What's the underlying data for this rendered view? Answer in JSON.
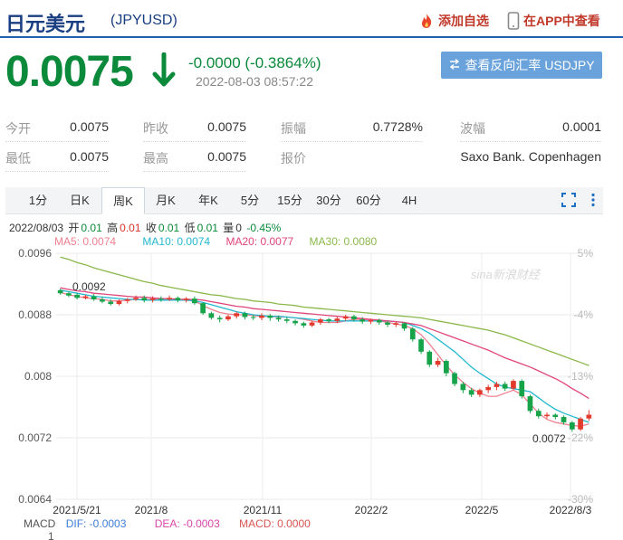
{
  "header": {
    "title": "日元美元",
    "code": "(JPYUSD)",
    "add_watch": "添加自选",
    "app_view": "在APP中查看"
  },
  "quote": {
    "price": "0.0075",
    "change": "-0.0000 (-0.3864%)",
    "time": "2022-08-03 08:57:22",
    "reverse_label": "查看反向汇率 USDJPY"
  },
  "stats": [
    {
      "label": "今开",
      "value": "0.0075"
    },
    {
      "label": "昨收",
      "value": "0.0075"
    },
    {
      "label": "振幅",
      "value": "0.7728%"
    },
    {
      "label": "波幅",
      "value": "0.0001"
    },
    {
      "label": "最低",
      "value": "0.0075"
    },
    {
      "label": "最高",
      "value": "0.0075"
    },
    {
      "label": "报价",
      "value": "Saxo Bank. Copenhagen"
    }
  ],
  "tabs": [
    "1分",
    "日K",
    "周K",
    "月K",
    "年K",
    "5分",
    "15分",
    "30分",
    "60分",
    "4H"
  ],
  "active_tab": "周K",
  "ohlc": {
    "date": "2022/08/03",
    "open_label": "开",
    "open": "0.01",
    "high_label": "高",
    "high": "0.01",
    "close_label": "收",
    "close": "0.01",
    "low_label": "低",
    "low": "0.01",
    "vol_label": "量",
    "vol": "0",
    "pct": "-0.45%"
  },
  "ma_legend": [
    {
      "text": "MA5: 0.0074",
      "color": "#f08090"
    },
    {
      "text": "MA10: 0.0074",
      "color": "#22b8cf"
    },
    {
      "text": "MA20: 0.0077",
      "color": "#e0457b"
    },
    {
      "text": "MA30: 0.0080",
      "color": "#8ab84a"
    }
  ],
  "macd": {
    "label": "MACD",
    "dif": "DIF: -0.0003",
    "dea": "DEA: -0.0003",
    "macd": "MACD: 0.0000",
    "dif_color": "#3b7dd8",
    "dea_color": "#d946a8",
    "macd_color": "#d9534f",
    "scale_top": "1"
  },
  "watermark": "sina新浪财经",
  "chart_data": {
    "type": "candlestick",
    "y_ticks": [
      "0.0096",
      "0.0088",
      "0.008",
      "0.0072",
      "0.0064"
    ],
    "ylim": [
      0.0064,
      0.0096
    ],
    "pct_ticks": [
      "5%",
      "-4%",
      "-13%",
      "-22%",
      "-30%"
    ],
    "x_ticks": [
      "2021/5/21",
      "2021/8",
      "2021/11",
      "2022/2",
      "2022/5",
      "2022/8/3"
    ],
    "max_label": "0.0092",
    "min_label": "0.0072",
    "series": [
      {
        "name": "MA5",
        "color": "#f08090",
        "values": [
          0.00909,
          0.00906,
          0.00904,
          0.00902,
          0.00901,
          0.009,
          0.00898,
          0.00898,
          0.00899,
          0.009,
          0.009,
          0.009,
          0.009,
          0.00899,
          0.00899,
          0.00899,
          0.00898,
          0.00892,
          0.00887,
          0.00883,
          0.00881,
          0.0088,
          0.0088,
          0.00879,
          0.00878,
          0.00878,
          0.00877,
          0.00877,
          0.00876,
          0.00874,
          0.00872,
          0.0087,
          0.0087,
          0.0087,
          0.00872,
          0.00874,
          0.00874,
          0.00873,
          0.00872,
          0.0087,
          0.00868,
          0.00866,
          0.00862,
          0.00854,
          0.00842,
          0.00828,
          0.00814,
          0.00802,
          0.00792,
          0.00784,
          0.00778,
          0.00774,
          0.00774,
          0.00778,
          0.00782,
          0.00776,
          0.00764,
          0.00752,
          0.00744,
          0.0074,
          0.00738,
          0.00736,
          0.00735,
          0.00738
        ]
      },
      {
        "name": "MA10",
        "color": "#22b8cf",
        "values": [
          0.00912,
          0.0091,
          0.00908,
          0.00906,
          0.00904,
          0.00903,
          0.00902,
          0.00901,
          0.009,
          0.009,
          0.00899,
          0.00899,
          0.00899,
          0.00899,
          0.00899,
          0.00899,
          0.00898,
          0.00896,
          0.00893,
          0.0089,
          0.00887,
          0.00884,
          0.00882,
          0.0088,
          0.00879,
          0.00878,
          0.00878,
          0.00877,
          0.00876,
          0.00875,
          0.00874,
          0.00873,
          0.00872,
          0.00872,
          0.00872,
          0.00872,
          0.00872,
          0.00872,
          0.00872,
          0.00872,
          0.00871,
          0.0087,
          0.00866,
          0.00862,
          0.00856,
          0.00848,
          0.0084,
          0.00832,
          0.00822,
          0.00812,
          0.00804,
          0.00797,
          0.0079,
          0.00786,
          0.00784,
          0.00782,
          0.0078,
          0.00772,
          0.00764,
          0.00757,
          0.00752,
          0.00748,
          0.00744,
          0.0074
        ]
      },
      {
        "name": "MA20",
        "color": "#e0457b",
        "values": [
          0.00915,
          0.00913,
          0.00911,
          0.0091,
          0.00908,
          0.00907,
          0.00906,
          0.00905,
          0.00904,
          0.00903,
          0.00903,
          0.00902,
          0.00901,
          0.00901,
          0.009,
          0.009,
          0.009,
          0.00899,
          0.00897,
          0.00895,
          0.00893,
          0.00891,
          0.0089,
          0.00888,
          0.00887,
          0.00886,
          0.00885,
          0.00884,
          0.00883,
          0.00882,
          0.00881,
          0.0088,
          0.00879,
          0.00878,
          0.00877,
          0.00876,
          0.00875,
          0.00874,
          0.00873,
          0.00872,
          0.00871,
          0.0087,
          0.00868,
          0.00866,
          0.00862,
          0.00858,
          0.00854,
          0.0085,
          0.00846,
          0.00842,
          0.00838,
          0.00834,
          0.00829,
          0.00824,
          0.0082,
          0.00816,
          0.00812,
          0.00807,
          0.00802,
          0.00797,
          0.00791,
          0.00784,
          0.00778,
          0.00771
        ]
      },
      {
        "name": "MA30",
        "color": "#8ab84a",
        "values": [
          0.00955,
          0.00952,
          0.00948,
          0.00945,
          0.00941,
          0.00938,
          0.00935,
          0.00932,
          0.00929,
          0.00926,
          0.00923,
          0.00921,
          0.00918,
          0.00916,
          0.00914,
          0.00912,
          0.0091,
          0.00908,
          0.00906,
          0.00905,
          0.00903,
          0.00901,
          0.009,
          0.00898,
          0.00897,
          0.00896,
          0.00894,
          0.00893,
          0.00892,
          0.0089,
          0.00889,
          0.00888,
          0.00887,
          0.00886,
          0.00885,
          0.00884,
          0.00883,
          0.00882,
          0.00881,
          0.0088,
          0.00879,
          0.00878,
          0.00877,
          0.00876,
          0.00874,
          0.00872,
          0.0087,
          0.00868,
          0.00866,
          0.00864,
          0.00862,
          0.0086,
          0.00857,
          0.00854,
          0.0085,
          0.00846,
          0.00842,
          0.00838,
          0.00834,
          0.0083,
          0.00826,
          0.00822,
          0.00818,
          0.00814
        ]
      }
    ],
    "candles": [
      [
        0.00912,
        0.00908,
        0.00914,
        0.00906
      ],
      [
        0.00908,
        0.00905,
        0.0091,
        0.00903
      ],
      [
        0.00906,
        0.00902,
        0.00908,
        0.009
      ],
      [
        0.00902,
        0.00904,
        0.00906,
        0.009
      ],
      [
        0.00904,
        0.009,
        0.00907,
        0.00898
      ],
      [
        0.009,
        0.00897,
        0.00903,
        0.00895
      ],
      [
        0.00897,
        0.00894,
        0.009,
        0.00892
      ],
      [
        0.00894,
        0.00898,
        0.009,
        0.00892
      ],
      [
        0.00898,
        0.009,
        0.00902,
        0.00895
      ],
      [
        0.009,
        0.00902,
        0.00905,
        0.00898
      ],
      [
        0.00902,
        0.00899,
        0.00905,
        0.00896
      ],
      [
        0.00899,
        0.00901,
        0.00904,
        0.00896
      ],
      [
        0.00901,
        0.009,
        0.00904,
        0.00897
      ],
      [
        0.009,
        0.00902,
        0.00905,
        0.00898
      ],
      [
        0.00902,
        0.00899,
        0.00904,
        0.00896
      ],
      [
        0.00899,
        0.00901,
        0.00903,
        0.00896
      ],
      [
        0.00901,
        0.00895,
        0.00904,
        0.00893
      ],
      [
        0.00895,
        0.00882,
        0.00896,
        0.0088
      ],
      [
        0.00882,
        0.00876,
        0.00884,
        0.00874
      ],
      [
        0.00876,
        0.00874,
        0.00879,
        0.0087
      ],
      [
        0.00874,
        0.00878,
        0.0088,
        0.00872
      ],
      [
        0.00878,
        0.00882,
        0.00884,
        0.00875
      ],
      [
        0.00882,
        0.00877,
        0.00884,
        0.00874
      ],
      [
        0.00877,
        0.00876,
        0.0088,
        0.00873
      ],
      [
        0.00876,
        0.00879,
        0.00882,
        0.00873
      ],
      [
        0.00879,
        0.00876,
        0.00881,
        0.00872
      ],
      [
        0.00876,
        0.00874,
        0.00879,
        0.00871
      ],
      [
        0.00874,
        0.00872,
        0.00877,
        0.00869
      ],
      [
        0.00872,
        0.00869,
        0.00874,
        0.00866
      ],
      [
        0.00869,
        0.00866,
        0.00871,
        0.00863
      ],
      [
        0.00866,
        0.0087,
        0.00872,
        0.00864
      ],
      [
        0.0087,
        0.00874,
        0.00876,
        0.00867
      ],
      [
        0.00874,
        0.00872,
        0.00876,
        0.00869
      ],
      [
        0.00872,
        0.00875,
        0.00877,
        0.00869
      ],
      [
        0.00875,
        0.00878,
        0.0088,
        0.00872
      ],
      [
        0.00878,
        0.00874,
        0.0088,
        0.00871
      ],
      [
        0.00874,
        0.00871,
        0.00877,
        0.00868
      ],
      [
        0.00871,
        0.00873,
        0.00875,
        0.00868
      ],
      [
        0.00873,
        0.0087,
        0.00875,
        0.00867
      ],
      [
        0.0087,
        0.00867,
        0.00872,
        0.00864
      ],
      [
        0.00867,
        0.00869,
        0.00871,
        0.00864
      ],
      [
        0.00869,
        0.00862,
        0.0087,
        0.00859
      ],
      [
        0.00862,
        0.00848,
        0.00864,
        0.00845
      ],
      [
        0.00848,
        0.00832,
        0.0085,
        0.00829
      ],
      [
        0.00832,
        0.00815,
        0.00834,
        0.00812
      ],
      [
        0.00815,
        0.0082,
        0.00824,
        0.00812
      ],
      [
        0.0082,
        0.00804,
        0.00822,
        0.008
      ],
      [
        0.00804,
        0.0079,
        0.00806,
        0.00787
      ],
      [
        0.0079,
        0.00782,
        0.00793,
        0.00778
      ],
      [
        0.00782,
        0.00776,
        0.00785,
        0.00773
      ],
      [
        0.00776,
        0.00782,
        0.00784,
        0.00773
      ],
      [
        0.00782,
        0.00786,
        0.00789,
        0.00778
      ],
      [
        0.00786,
        0.0079,
        0.00793,
        0.00782
      ],
      [
        0.0079,
        0.00784,
        0.00793,
        0.00781
      ],
      [
        0.00784,
        0.00794,
        0.00796,
        0.00782
      ],
      [
        0.00794,
        0.00774,
        0.00796,
        0.00771
      ],
      [
        0.00774,
        0.00755,
        0.00776,
        0.00752
      ],
      [
        0.00755,
        0.00748,
        0.00758,
        0.00745
      ],
      [
        0.00748,
        0.0075,
        0.00753,
        0.00745
      ],
      [
        0.0075,
        0.00747,
        0.00752,
        0.00744
      ],
      [
        0.00747,
        0.0074,
        0.00749,
        0.00737
      ],
      [
        0.0074,
        0.00731,
        0.00742,
        0.00728
      ],
      [
        0.00731,
        0.00745,
        0.00747,
        0.00729
      ],
      [
        0.00745,
        0.0075,
        0.00756,
        0.00742
      ]
    ]
  }
}
